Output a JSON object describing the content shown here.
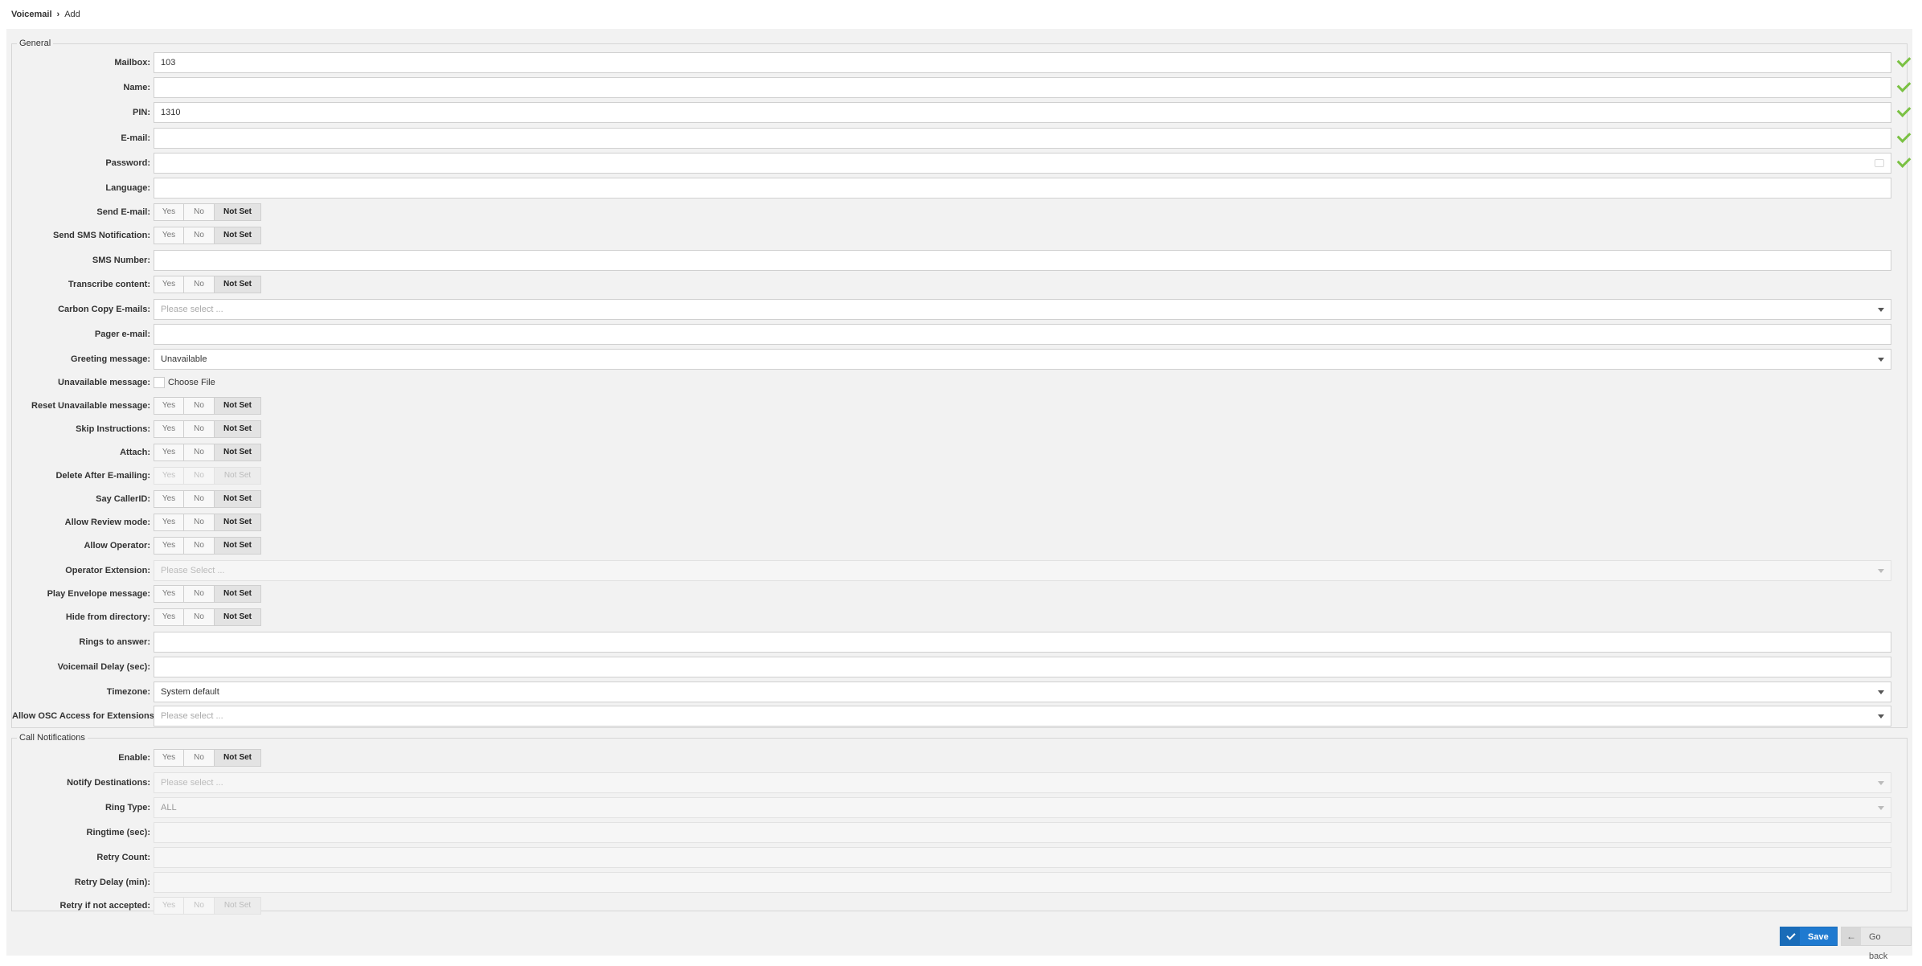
{
  "breadcrumb": {
    "root": "Voicemail",
    "separator": "›",
    "current": "Add"
  },
  "general": {
    "legend": "General",
    "mailbox": {
      "label": "Mailbox:",
      "value": "103"
    },
    "name": {
      "label": "Name:",
      "value": ""
    },
    "pin": {
      "label": "PIN:",
      "value": "1310"
    },
    "email": {
      "label": "E-mail:",
      "value": ""
    },
    "password": {
      "label": "Password:",
      "value": ""
    },
    "language": {
      "label": "Language:",
      "value": ""
    },
    "send_email": {
      "label": "Send E-mail:"
    },
    "send_sms": {
      "label": "Send SMS Notification:"
    },
    "sms_number": {
      "label": "SMS Number:",
      "value": ""
    },
    "transcribe": {
      "label": "Transcribe content:"
    },
    "cc_emails": {
      "label": "Carbon Copy E-mails:",
      "placeholder": "Please select ..."
    },
    "pager_email": {
      "label": "Pager e-mail:",
      "value": ""
    },
    "greeting": {
      "label": "Greeting message:",
      "value": "Unavailable"
    },
    "unavailable_msg": {
      "label": "Unavailable message:",
      "file_label": "Choose File"
    },
    "reset_unavailable": {
      "label": "Reset Unavailable message:"
    },
    "skip_instructions": {
      "label": "Skip Instructions:"
    },
    "attach": {
      "label": "Attach:"
    },
    "delete_after": {
      "label": "Delete After E-mailing:"
    },
    "say_callerid": {
      "label": "Say CallerID:"
    },
    "allow_review": {
      "label": "Allow Review mode:"
    },
    "allow_operator": {
      "label": "Allow Operator:"
    },
    "operator_ext": {
      "label": "Operator Extension:",
      "placeholder": "Please Select ..."
    },
    "play_envelope": {
      "label": "Play Envelope message:"
    },
    "hide_directory": {
      "label": "Hide from directory:"
    },
    "rings": {
      "label": "Rings to answer:",
      "value": ""
    },
    "vm_delay": {
      "label": "Voicemail Delay (sec):",
      "value": ""
    },
    "timezone": {
      "label": "Timezone:",
      "value": "System default"
    },
    "osc_access": {
      "label": "Allow OSC Access for Extensions:",
      "placeholder": "Please select ..."
    }
  },
  "call_notifications": {
    "legend": "Call Notifications",
    "enable": {
      "label": "Enable:"
    },
    "notify_dest": {
      "label": "Notify Destinations:",
      "placeholder": "Please select ..."
    },
    "ring_type": {
      "label": "Ring Type:",
      "value": "ALL"
    },
    "ringtime": {
      "label": "Ringtime (sec):",
      "value": ""
    },
    "retry_count": {
      "label": "Retry Count:",
      "value": ""
    },
    "retry_delay": {
      "label": "Retry Delay (min):",
      "value": ""
    },
    "retry_not_accepted": {
      "label": "Retry if not accepted:"
    }
  },
  "toggle": {
    "yes": "Yes",
    "no": "No",
    "not_set": "Not Set"
  },
  "buttons": {
    "save": "Save",
    "back": "Go back"
  },
  "colors": {
    "accent": "#1f7ad0",
    "valid_check": "#7ac143",
    "background": "#f2f2f2"
  }
}
